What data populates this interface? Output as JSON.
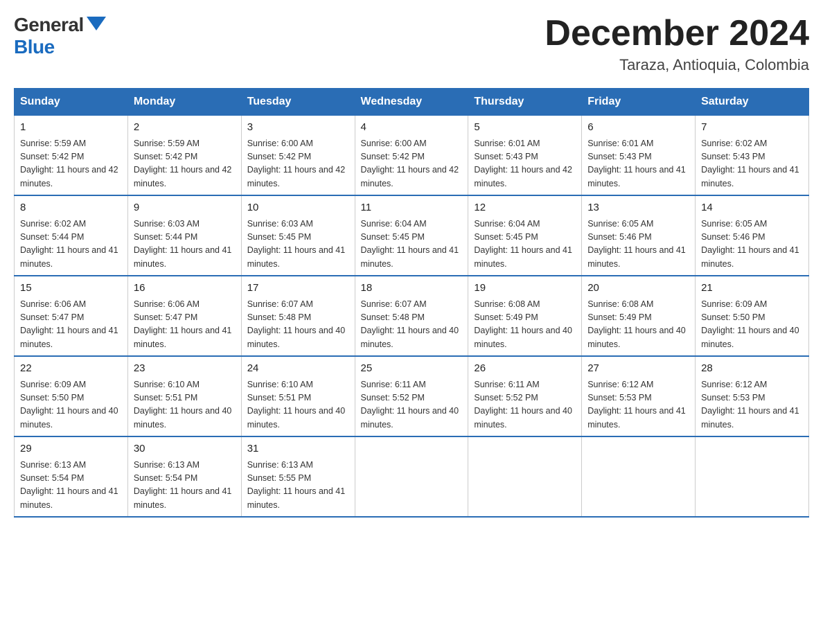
{
  "logo": {
    "general": "General",
    "blue": "Blue"
  },
  "title": {
    "month": "December 2024",
    "location": "Taraza, Antioquia, Colombia"
  },
  "headers": [
    "Sunday",
    "Monday",
    "Tuesday",
    "Wednesday",
    "Thursday",
    "Friday",
    "Saturday"
  ],
  "weeks": [
    [
      {
        "day": "1",
        "sunrise": "Sunrise: 5:59 AM",
        "sunset": "Sunset: 5:42 PM",
        "daylight": "Daylight: 11 hours and 42 minutes."
      },
      {
        "day": "2",
        "sunrise": "Sunrise: 5:59 AM",
        "sunset": "Sunset: 5:42 PM",
        "daylight": "Daylight: 11 hours and 42 minutes."
      },
      {
        "day": "3",
        "sunrise": "Sunrise: 6:00 AM",
        "sunset": "Sunset: 5:42 PM",
        "daylight": "Daylight: 11 hours and 42 minutes."
      },
      {
        "day": "4",
        "sunrise": "Sunrise: 6:00 AM",
        "sunset": "Sunset: 5:42 PM",
        "daylight": "Daylight: 11 hours and 42 minutes."
      },
      {
        "day": "5",
        "sunrise": "Sunrise: 6:01 AM",
        "sunset": "Sunset: 5:43 PM",
        "daylight": "Daylight: 11 hours and 42 minutes."
      },
      {
        "day": "6",
        "sunrise": "Sunrise: 6:01 AM",
        "sunset": "Sunset: 5:43 PM",
        "daylight": "Daylight: 11 hours and 41 minutes."
      },
      {
        "day": "7",
        "sunrise": "Sunrise: 6:02 AM",
        "sunset": "Sunset: 5:43 PM",
        "daylight": "Daylight: 11 hours and 41 minutes."
      }
    ],
    [
      {
        "day": "8",
        "sunrise": "Sunrise: 6:02 AM",
        "sunset": "Sunset: 5:44 PM",
        "daylight": "Daylight: 11 hours and 41 minutes."
      },
      {
        "day": "9",
        "sunrise": "Sunrise: 6:03 AM",
        "sunset": "Sunset: 5:44 PM",
        "daylight": "Daylight: 11 hours and 41 minutes."
      },
      {
        "day": "10",
        "sunrise": "Sunrise: 6:03 AM",
        "sunset": "Sunset: 5:45 PM",
        "daylight": "Daylight: 11 hours and 41 minutes."
      },
      {
        "day": "11",
        "sunrise": "Sunrise: 6:04 AM",
        "sunset": "Sunset: 5:45 PM",
        "daylight": "Daylight: 11 hours and 41 minutes."
      },
      {
        "day": "12",
        "sunrise": "Sunrise: 6:04 AM",
        "sunset": "Sunset: 5:45 PM",
        "daylight": "Daylight: 11 hours and 41 minutes."
      },
      {
        "day": "13",
        "sunrise": "Sunrise: 6:05 AM",
        "sunset": "Sunset: 5:46 PM",
        "daylight": "Daylight: 11 hours and 41 minutes."
      },
      {
        "day": "14",
        "sunrise": "Sunrise: 6:05 AM",
        "sunset": "Sunset: 5:46 PM",
        "daylight": "Daylight: 11 hours and 41 minutes."
      }
    ],
    [
      {
        "day": "15",
        "sunrise": "Sunrise: 6:06 AM",
        "sunset": "Sunset: 5:47 PM",
        "daylight": "Daylight: 11 hours and 41 minutes."
      },
      {
        "day": "16",
        "sunrise": "Sunrise: 6:06 AM",
        "sunset": "Sunset: 5:47 PM",
        "daylight": "Daylight: 11 hours and 41 minutes."
      },
      {
        "day": "17",
        "sunrise": "Sunrise: 6:07 AM",
        "sunset": "Sunset: 5:48 PM",
        "daylight": "Daylight: 11 hours and 40 minutes."
      },
      {
        "day": "18",
        "sunrise": "Sunrise: 6:07 AM",
        "sunset": "Sunset: 5:48 PM",
        "daylight": "Daylight: 11 hours and 40 minutes."
      },
      {
        "day": "19",
        "sunrise": "Sunrise: 6:08 AM",
        "sunset": "Sunset: 5:49 PM",
        "daylight": "Daylight: 11 hours and 40 minutes."
      },
      {
        "day": "20",
        "sunrise": "Sunrise: 6:08 AM",
        "sunset": "Sunset: 5:49 PM",
        "daylight": "Daylight: 11 hours and 40 minutes."
      },
      {
        "day": "21",
        "sunrise": "Sunrise: 6:09 AM",
        "sunset": "Sunset: 5:50 PM",
        "daylight": "Daylight: 11 hours and 40 minutes."
      }
    ],
    [
      {
        "day": "22",
        "sunrise": "Sunrise: 6:09 AM",
        "sunset": "Sunset: 5:50 PM",
        "daylight": "Daylight: 11 hours and 40 minutes."
      },
      {
        "day": "23",
        "sunrise": "Sunrise: 6:10 AM",
        "sunset": "Sunset: 5:51 PM",
        "daylight": "Daylight: 11 hours and 40 minutes."
      },
      {
        "day": "24",
        "sunrise": "Sunrise: 6:10 AM",
        "sunset": "Sunset: 5:51 PM",
        "daylight": "Daylight: 11 hours and 40 minutes."
      },
      {
        "day": "25",
        "sunrise": "Sunrise: 6:11 AM",
        "sunset": "Sunset: 5:52 PM",
        "daylight": "Daylight: 11 hours and 40 minutes."
      },
      {
        "day": "26",
        "sunrise": "Sunrise: 6:11 AM",
        "sunset": "Sunset: 5:52 PM",
        "daylight": "Daylight: 11 hours and 40 minutes."
      },
      {
        "day": "27",
        "sunrise": "Sunrise: 6:12 AM",
        "sunset": "Sunset: 5:53 PM",
        "daylight": "Daylight: 11 hours and 41 minutes."
      },
      {
        "day": "28",
        "sunrise": "Sunrise: 6:12 AM",
        "sunset": "Sunset: 5:53 PM",
        "daylight": "Daylight: 11 hours and 41 minutes."
      }
    ],
    [
      {
        "day": "29",
        "sunrise": "Sunrise: 6:13 AM",
        "sunset": "Sunset: 5:54 PM",
        "daylight": "Daylight: 11 hours and 41 minutes."
      },
      {
        "day": "30",
        "sunrise": "Sunrise: 6:13 AM",
        "sunset": "Sunset: 5:54 PM",
        "daylight": "Daylight: 11 hours and 41 minutes."
      },
      {
        "day": "31",
        "sunrise": "Sunrise: 6:13 AM",
        "sunset": "Sunset: 5:55 PM",
        "daylight": "Daylight: 11 hours and 41 minutes."
      },
      null,
      null,
      null,
      null
    ]
  ]
}
